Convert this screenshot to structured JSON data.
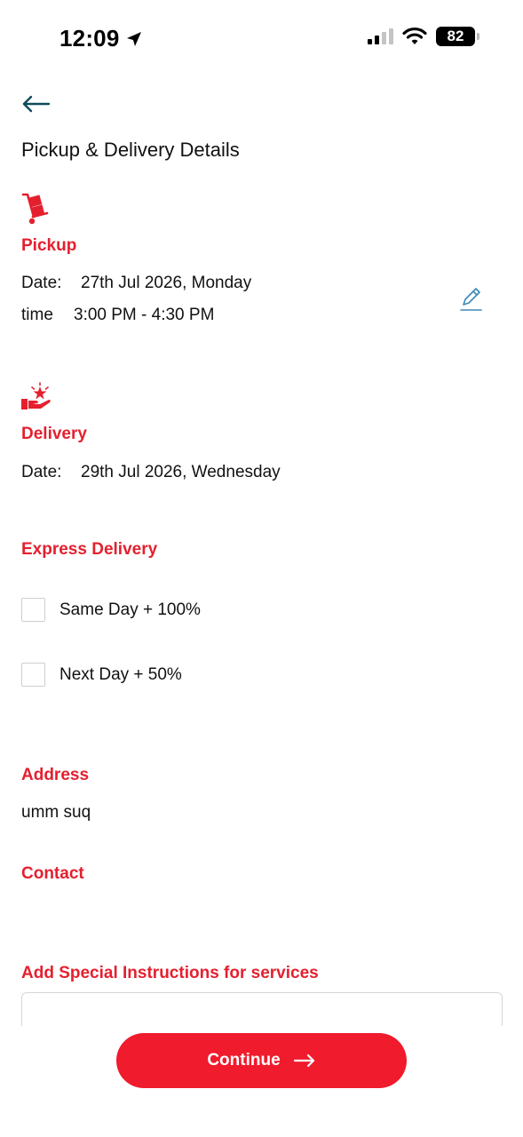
{
  "status_bar": {
    "time": "12:09",
    "battery": "82"
  },
  "page": {
    "title": "Pickup & Delivery Details"
  },
  "pickup": {
    "heading": "Pickup",
    "date_label": "Date:",
    "date_value": "27th Jul 2026, Monday",
    "time_label": "time",
    "time_value": "3:00 PM - 4:30 PM",
    "icon": "hand-truck-icon"
  },
  "delivery": {
    "heading": "Delivery",
    "date_label": "Date:",
    "date_value": "29th Jul 2026, Wednesday",
    "icon": "hand-star-icon"
  },
  "express": {
    "heading": "Express Delivery",
    "options": [
      {
        "label": "Same Day + 100%",
        "checked": false
      },
      {
        "label": "Next Day + 50%",
        "checked": false
      }
    ]
  },
  "address": {
    "heading": "Address",
    "value": "umm suq"
  },
  "contact": {
    "heading": "Contact",
    "value": ""
  },
  "instructions": {
    "heading": "Add Special Instructions for services",
    "value": ""
  },
  "continue": {
    "label": "Continue"
  },
  "colors": {
    "accent": "#e4202f",
    "button": "#f01b2d",
    "edit_icon": "#3b8ab5",
    "back_arrow": "#0e4a5c"
  }
}
